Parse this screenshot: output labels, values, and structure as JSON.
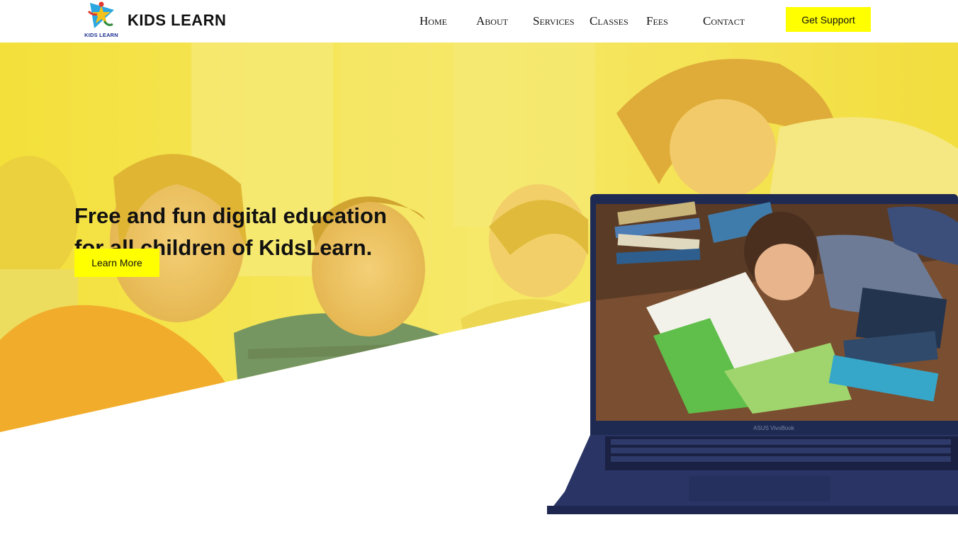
{
  "header": {
    "logo_caption": "KIDS LEARN",
    "brand": "KIDS LEARN",
    "nav": [
      "Home",
      "About",
      "Services",
      "Classes",
      "Fees",
      "Contact"
    ],
    "support_label": "Get Support"
  },
  "hero": {
    "headline_line1": "Free and fun digital education",
    "headline_line2": "for all children of KidsLearn.",
    "cta_label": "Learn More",
    "laptop_brand": "ASUS VivoBook"
  },
  "colors": {
    "accent": "#ffff00",
    "hero_overlay": "#f4e03c",
    "laptop_body": "#2a3566"
  }
}
